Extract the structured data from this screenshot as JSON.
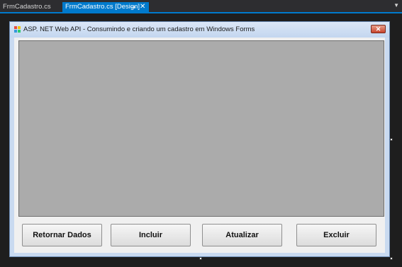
{
  "ide": {
    "tabs": [
      {
        "label": "FrmCadastro.cs",
        "active": false
      },
      {
        "label": "FrmCadastro.cs [Design]",
        "active": true
      }
    ],
    "accent_color": "#007acc"
  },
  "form": {
    "title": "ASP. NET Web API - Consumindo e criando um cadastro em Windows Forms",
    "close_glyph": "✕",
    "grid_color": "#ababab",
    "buttons": {
      "retornar": "Retornar Dados",
      "incluir": "Incluir",
      "atualizar": "Atualizar",
      "excluir": "Excluir"
    }
  }
}
